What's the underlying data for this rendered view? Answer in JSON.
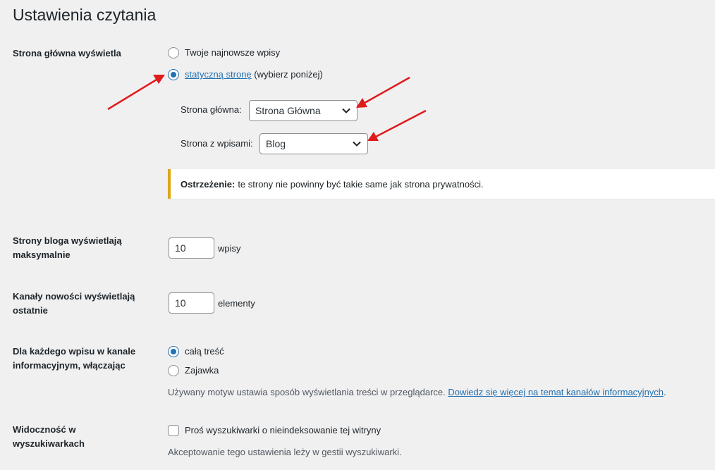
{
  "page_title": "Ustawienia czytania",
  "front_page": {
    "label": "Strona główna wyświetla",
    "option_latest": "Twoje najnowsze wpisy",
    "option_static_link": "statyczną stronę",
    "option_static_suffix": " (wybierz poniżej)",
    "homepage_label": "Strona główna:",
    "homepage_value": "Strona Główna",
    "posts_page_label": "Strona z wpisami:",
    "posts_page_value": "Blog",
    "warning_bold": "Ostrzeżenie:",
    "warning_text": "te strony nie powinny być takie same jak strona prywatności."
  },
  "posts_per_page": {
    "label": "Strony bloga wyświetlają maksymalnie",
    "value": "10",
    "unit": "wpisy"
  },
  "feed_items": {
    "label": "Kanały nowości wyświetlają ostatnie",
    "value": "10",
    "unit": "elementy"
  },
  "feed_content": {
    "label": "Dla każdego wpisu w kanale informacyjnym, włączając",
    "option_full": "całą treść",
    "option_excerpt": "Zajawka",
    "desc_text": "Używany motyw ustawia sposób wyświetlania treści w przeglądarce. ",
    "desc_link": "Dowiedz się więcej na temat kanałów informacyjnych",
    "desc_end": "."
  },
  "search_visibility": {
    "label": "Widoczność w wyszukiwarkach",
    "checkbox_label": "Proś wyszukiwarki o nieindeksowanie tej witryny",
    "desc": "Akceptowanie tego ustawienia leży w gestii wyszukiwarki."
  },
  "colors": {
    "accent": "#2271b1",
    "warning_border": "#dba617",
    "annotation_arrow": "#e01b1b",
    "background": "#f0f0f1"
  },
  "icons": [
    "chevron-down-icon",
    "annotation-arrow"
  ]
}
